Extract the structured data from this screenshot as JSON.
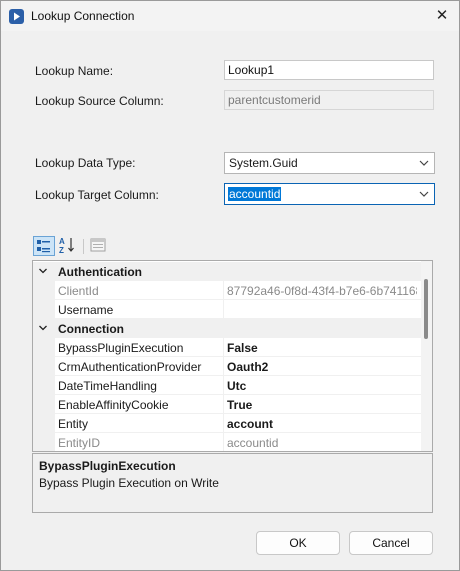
{
  "window": {
    "title": "Lookup Connection",
    "close_glyph": "✕"
  },
  "form": {
    "lookup_name": {
      "label": "Lookup Name:",
      "value": "Lookup1"
    },
    "lookup_source_column": {
      "label": "Lookup Source Column:",
      "value": "parentcustomerid"
    },
    "lookup_data_type": {
      "label": "Lookup Data Type:",
      "value": "System.Guid"
    },
    "lookup_target_column": {
      "label": "Lookup Target Column:",
      "value": "accountid"
    }
  },
  "toolbar": {
    "icons": [
      "categorized-view-icon",
      "alphabetical-sort-icon",
      "property-pages-icon"
    ]
  },
  "property_grid": {
    "rows": [
      {
        "kind": "category",
        "label": "Authentication"
      },
      {
        "kind": "property",
        "name": "ClientId",
        "value": "87792a46-0f8d-43f4-b7e6-6b741168",
        "readonly": true,
        "bold": false
      },
      {
        "kind": "property",
        "name": "Username",
        "value": "",
        "readonly": false,
        "bold": false
      },
      {
        "kind": "category",
        "label": "Connection"
      },
      {
        "kind": "property",
        "name": "BypassPluginExecution",
        "value": "False",
        "readonly": false,
        "bold": true
      },
      {
        "kind": "property",
        "name": "CrmAuthenticationProvider",
        "value": "Oauth2",
        "readonly": false,
        "bold": true
      },
      {
        "kind": "property",
        "name": "DateTimeHandling",
        "value": "Utc",
        "readonly": false,
        "bold": true
      },
      {
        "kind": "property",
        "name": "EnableAffinityCookie",
        "value": "True",
        "readonly": false,
        "bold": true
      },
      {
        "kind": "property",
        "name": "Entity",
        "value": "account",
        "readonly": false,
        "bold": true
      },
      {
        "kind": "property",
        "name": "EntityID",
        "value": "accountid",
        "readonly": true,
        "bold": false
      }
    ]
  },
  "description": {
    "title": "BypassPluginExecution",
    "text": "Bypass Plugin Execution on Write"
  },
  "buttons": {
    "ok": "OK",
    "cancel": "Cancel"
  },
  "colors": {
    "accent": "#0078d7",
    "selection_bg": "#cce4f7"
  }
}
